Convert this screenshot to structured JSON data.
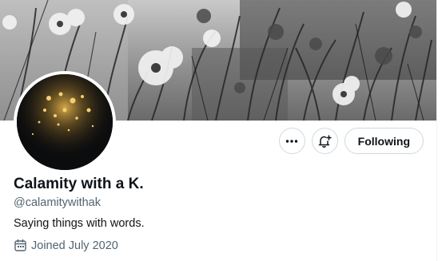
{
  "header": {
    "banner_icon": "flower-field-banner-photo",
    "avatar_icon": "bokeh-lights-avatar"
  },
  "actions": {
    "more_icon": "more-dots-icon",
    "notify_icon": "bell-plus-icon",
    "following_label": "Following"
  },
  "profile": {
    "display_name": "Calamity with a K.",
    "handle": "@calamitywithak",
    "bio": "Saying things with words.",
    "joined_icon": "calendar-icon",
    "joined": "Joined July 2020"
  },
  "colors": {
    "text_primary": "#0f1419",
    "text_secondary": "#536471",
    "border": "#cfd9de"
  }
}
